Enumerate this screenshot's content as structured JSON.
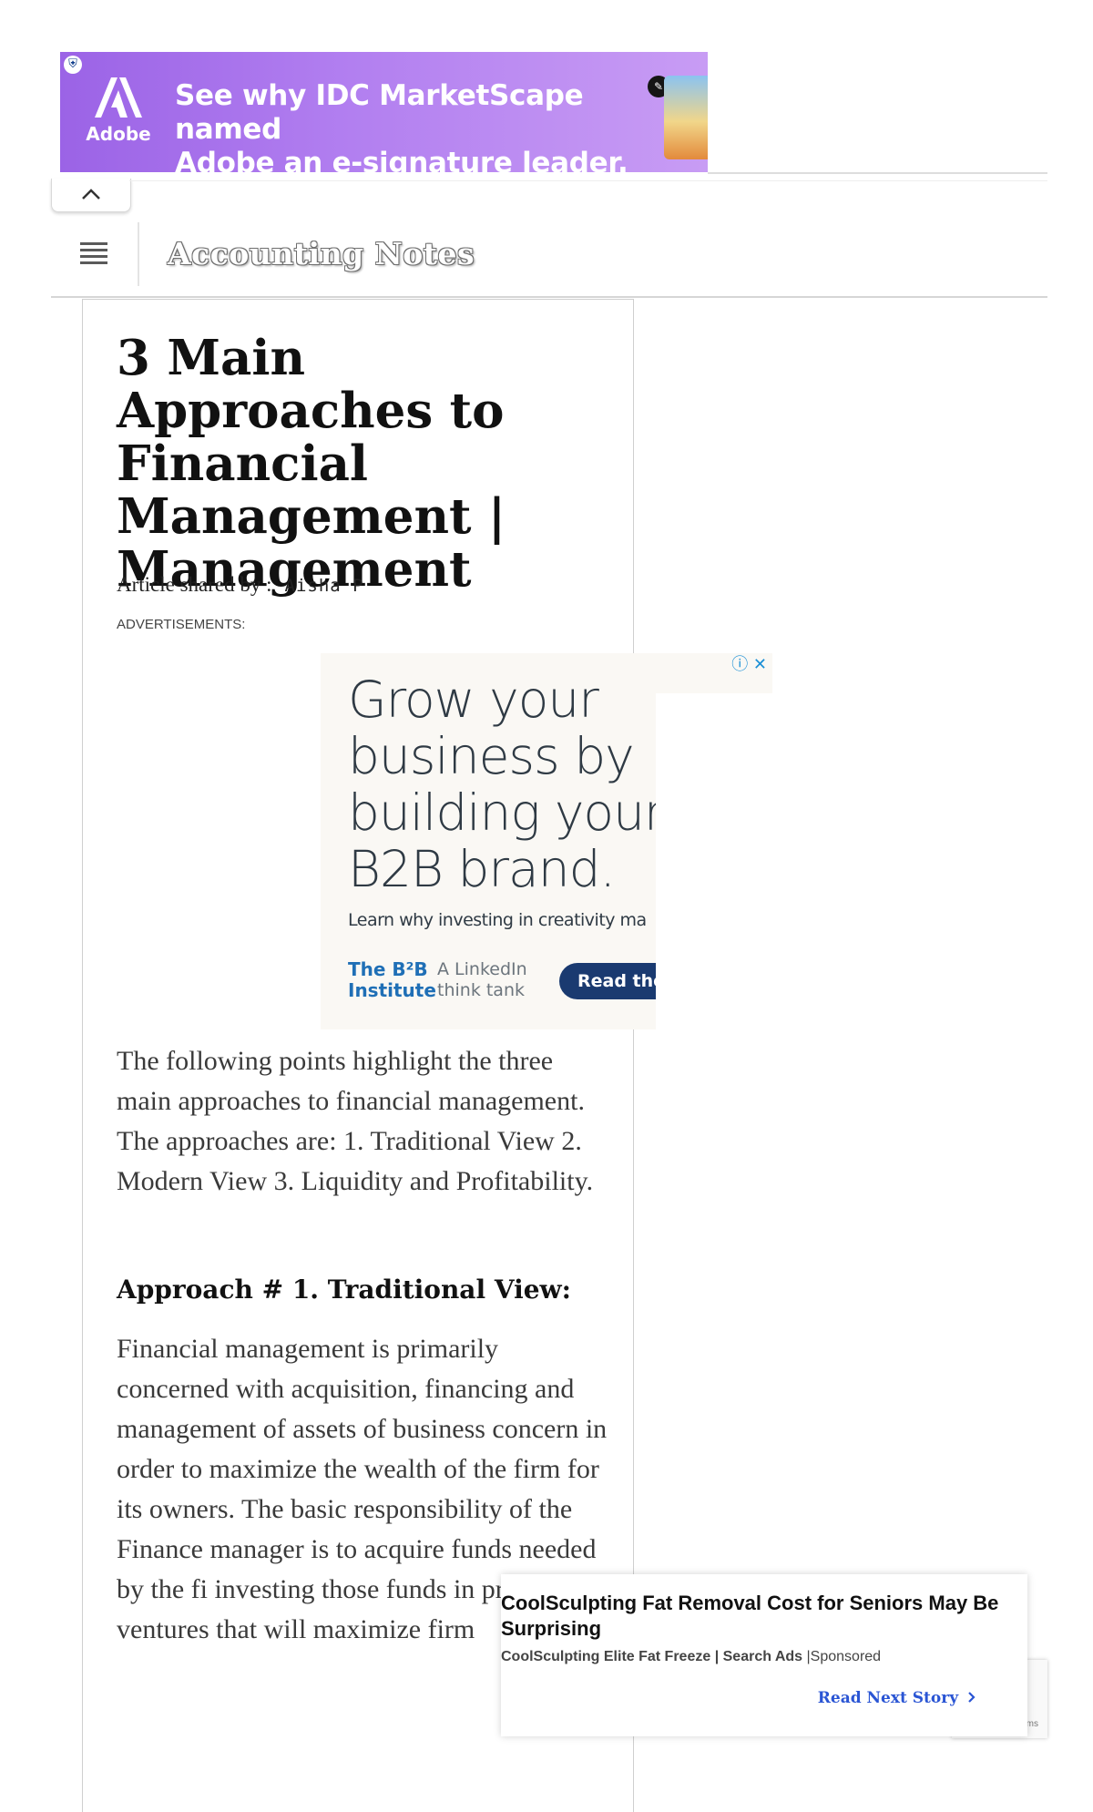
{
  "top_ad": {
    "brand": "Adobe",
    "headline_line1": "See why IDC MarketScape named",
    "headline_line2": "Adobe an e-signature leader.",
    "icon": "adchoices-shield-icon"
  },
  "header": {
    "site_title": "Accounting Notes",
    "menu_icon": "hamburger-icon",
    "collapse_icon": "chevron-up-icon"
  },
  "article": {
    "title": "3 Main Approaches to Financial Management | Management",
    "byline_label": "Article shared by :",
    "author": "Aisha P",
    "ads_label": "ADVERTISEMENTS:",
    "intro": "The following points highlight the three main approaches to financial management. The approaches are: 1. Traditional View 2. Modern View 3. Liquidity and Profitability.",
    "approach_1_heading": "Approach # 1. Traditional View:",
    "approach_1_text": "Financial management is primarily concerned with acquisition, financing and management of assets of business concern in order to maximize the wealth of the firm for its owners. The basic responsibility of the Finance manager is to acquire funds needed by the fi investing those funds in profitab ventures that will maximize firm"
  },
  "mid_ad": {
    "headline": "Grow your business by building your B2B brand.",
    "headline_lines": [
      "Grow your",
      "business by",
      "building your",
      "B2B brand."
    ],
    "subline": "Learn why investing in creativity ma",
    "logo_line1": "The B²B",
    "logo_line2": "Institute",
    "tank_line1": "A LinkedIn",
    "tank_line2": "think tank",
    "cta": "Read the",
    "choices_icons": "ⓘ ✕"
  },
  "sponsored": {
    "title": "CoolSculpting Fat Removal Cost for Seniors May Be Surprising",
    "source": "CoolSculpting Elite Fat Freeze | Search Ads",
    "separator": "|",
    "sponsored_label": "Sponsored",
    "read_next": "Read Next Story",
    "read_next_icon": "chevron-right-icon"
  },
  "recaptcha": {
    "text": "ms"
  },
  "colors": {
    "top_ad_purple": "#9b63e6",
    "read_next_blue": "#2a55d4",
    "b2b_blue": "#1f6fb6",
    "cta_navy": "#1a3a70"
  }
}
